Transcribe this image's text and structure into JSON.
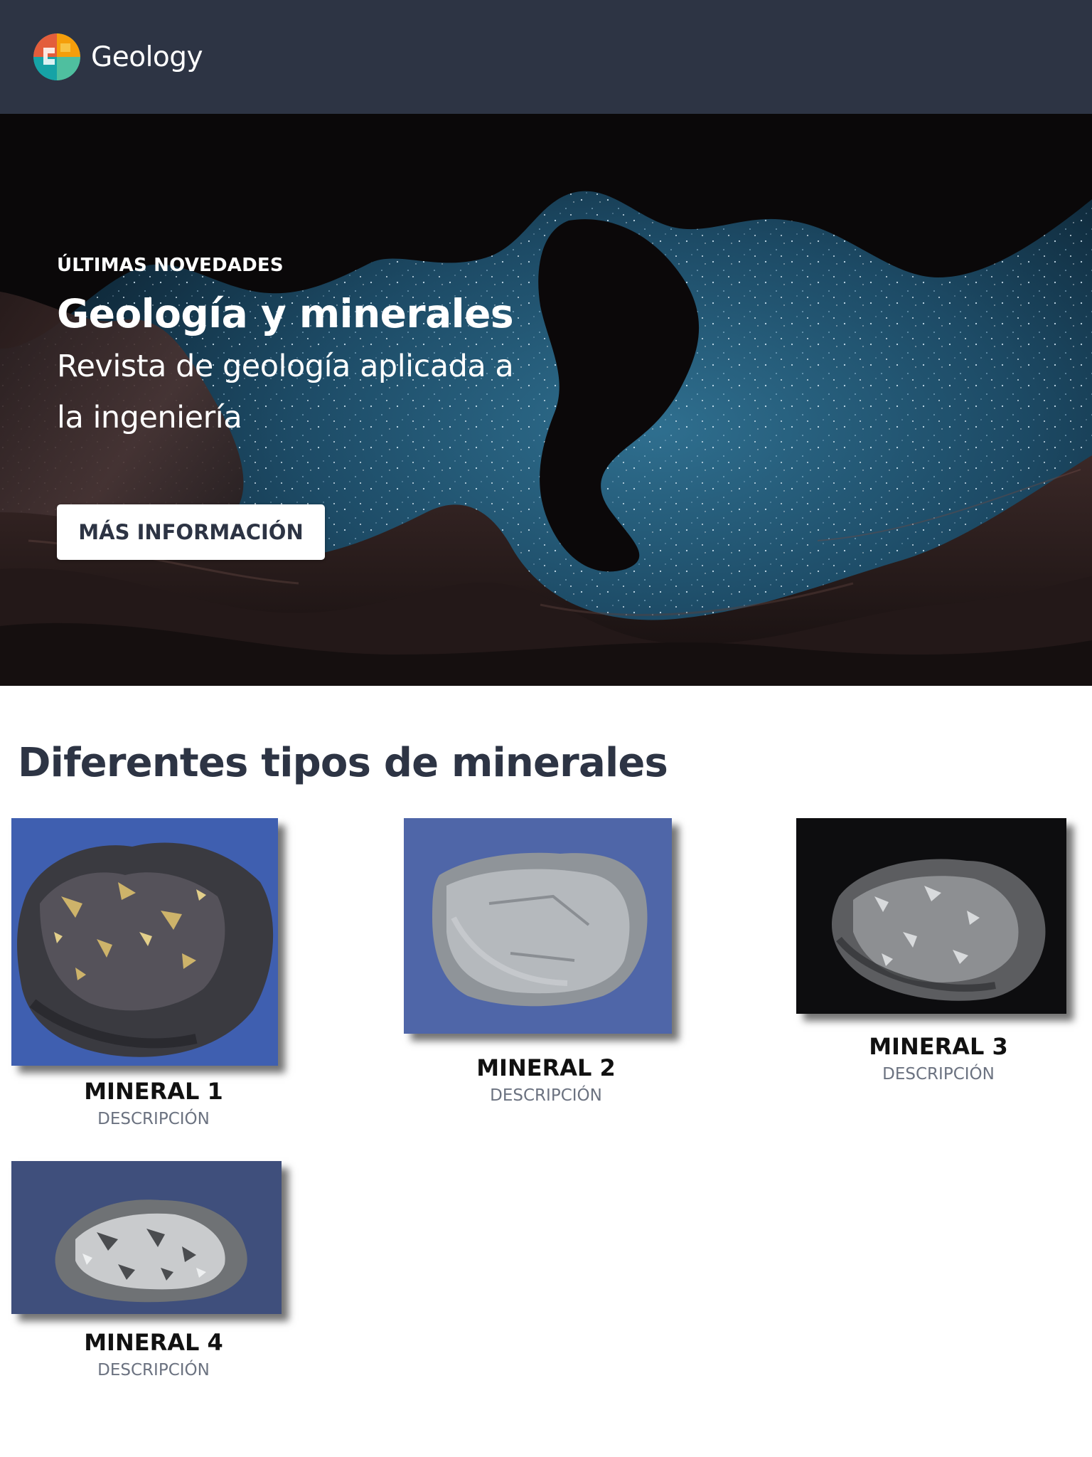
{
  "header": {
    "logo_icon": "globe-logo-icon",
    "brand": "Geology"
  },
  "hero": {
    "eyebrow": "ÚLTIMAS NOVEDADES",
    "title": "Geología y minerales",
    "subtitle": "Revista de geología aplicada a la ingeniería",
    "cta_label": "MÁS INFORMACIÓN",
    "background": "canyon-night-sky-image"
  },
  "minerals": {
    "title": "Diferentes tipos de minerales",
    "items": [
      {
        "name": "MINERAL 1",
        "description": "DESCRIPCIÓN",
        "image": "dark-rock-with-gold-flecks-image"
      },
      {
        "name": "MINERAL 2",
        "description": "DESCRIPCIÓN",
        "image": "grey-rock-on-blue-image"
      },
      {
        "name": "MINERAL 3",
        "description": "DESCRIPCIÓN",
        "image": "silver-ore-on-black-image"
      },
      {
        "name": "MINERAL 4",
        "description": "DESCRIPCIÓN",
        "image": "white-grey-rock-on-blue-image"
      }
    ]
  },
  "colors": {
    "header_bg": "#2d3444",
    "heading_text": "#2d3444",
    "muted_text": "#6b7280",
    "cta_bg": "#ffffff"
  }
}
